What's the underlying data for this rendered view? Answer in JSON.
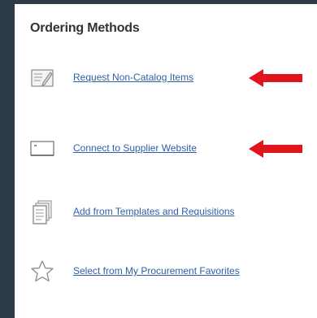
{
  "panel": {
    "title": "Ordering Methods"
  },
  "methods": [
    {
      "label": "Request Non-Catalog Items",
      "icon": "edit-form-icon",
      "highlighted": true
    },
    {
      "label": "Connect to Supplier Website",
      "icon": "monitor-icon",
      "highlighted": true
    },
    {
      "label": "Add from Templates and Requisitions",
      "icon": "documents-icon",
      "highlighted": false
    },
    {
      "label": "Select from My Procurement Favorites",
      "icon": "star-icon",
      "highlighted": false
    }
  ],
  "colors": {
    "background": "#2d3a48",
    "panel": "#ffffff",
    "link": "#2f5fa8",
    "arrow": "#e0141b",
    "icon": "#8a8a8a"
  }
}
